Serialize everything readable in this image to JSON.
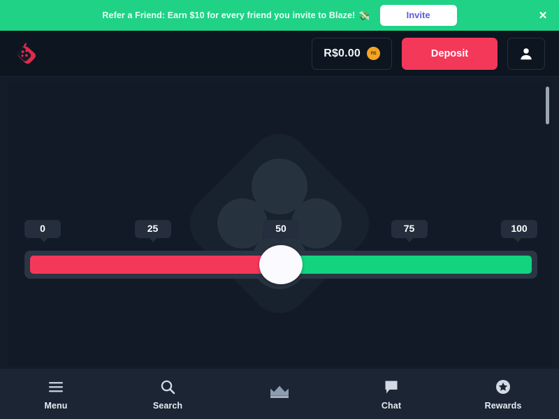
{
  "banner": {
    "text": "Refer a Friend: Earn $10 for every friend you invite to Blaze!",
    "emoji": "💸",
    "emoji_name": "money-with-wings-icon",
    "invite_label": "Invite",
    "close_label": "✕",
    "background_color": "#1fd286",
    "invite_text_color": "#5b5bd6"
  },
  "header": {
    "logo_name": "blaze-flame-logo",
    "balance": "R$0.00",
    "currency_badge": "R$",
    "deposit_label": "Deposit",
    "profile_label": "",
    "accent_color": "#f4385a",
    "coin_color": "#f5a524"
  },
  "slider": {
    "value": 50,
    "min": 0,
    "max": 100,
    "ticks": [
      {
        "label": "0",
        "value": 0
      },
      {
        "label": "25",
        "value": 25
      },
      {
        "label": "50",
        "value": 50
      },
      {
        "label": "75",
        "value": 75
      },
      {
        "label": "100",
        "value": 100
      }
    ],
    "left_color": "#f4385a",
    "right_color": "#12d47f"
  },
  "bottom_nav": {
    "items": [
      {
        "label": "Menu",
        "icon": "hamburger-menu-icon"
      },
      {
        "label": "Search",
        "icon": "search-icon"
      },
      {
        "label": "",
        "icon": "crown-icon"
      },
      {
        "label": "Chat",
        "icon": "chat-bubble-icon"
      },
      {
        "label": "Rewards",
        "icon": "star-badge-icon"
      }
    ]
  }
}
